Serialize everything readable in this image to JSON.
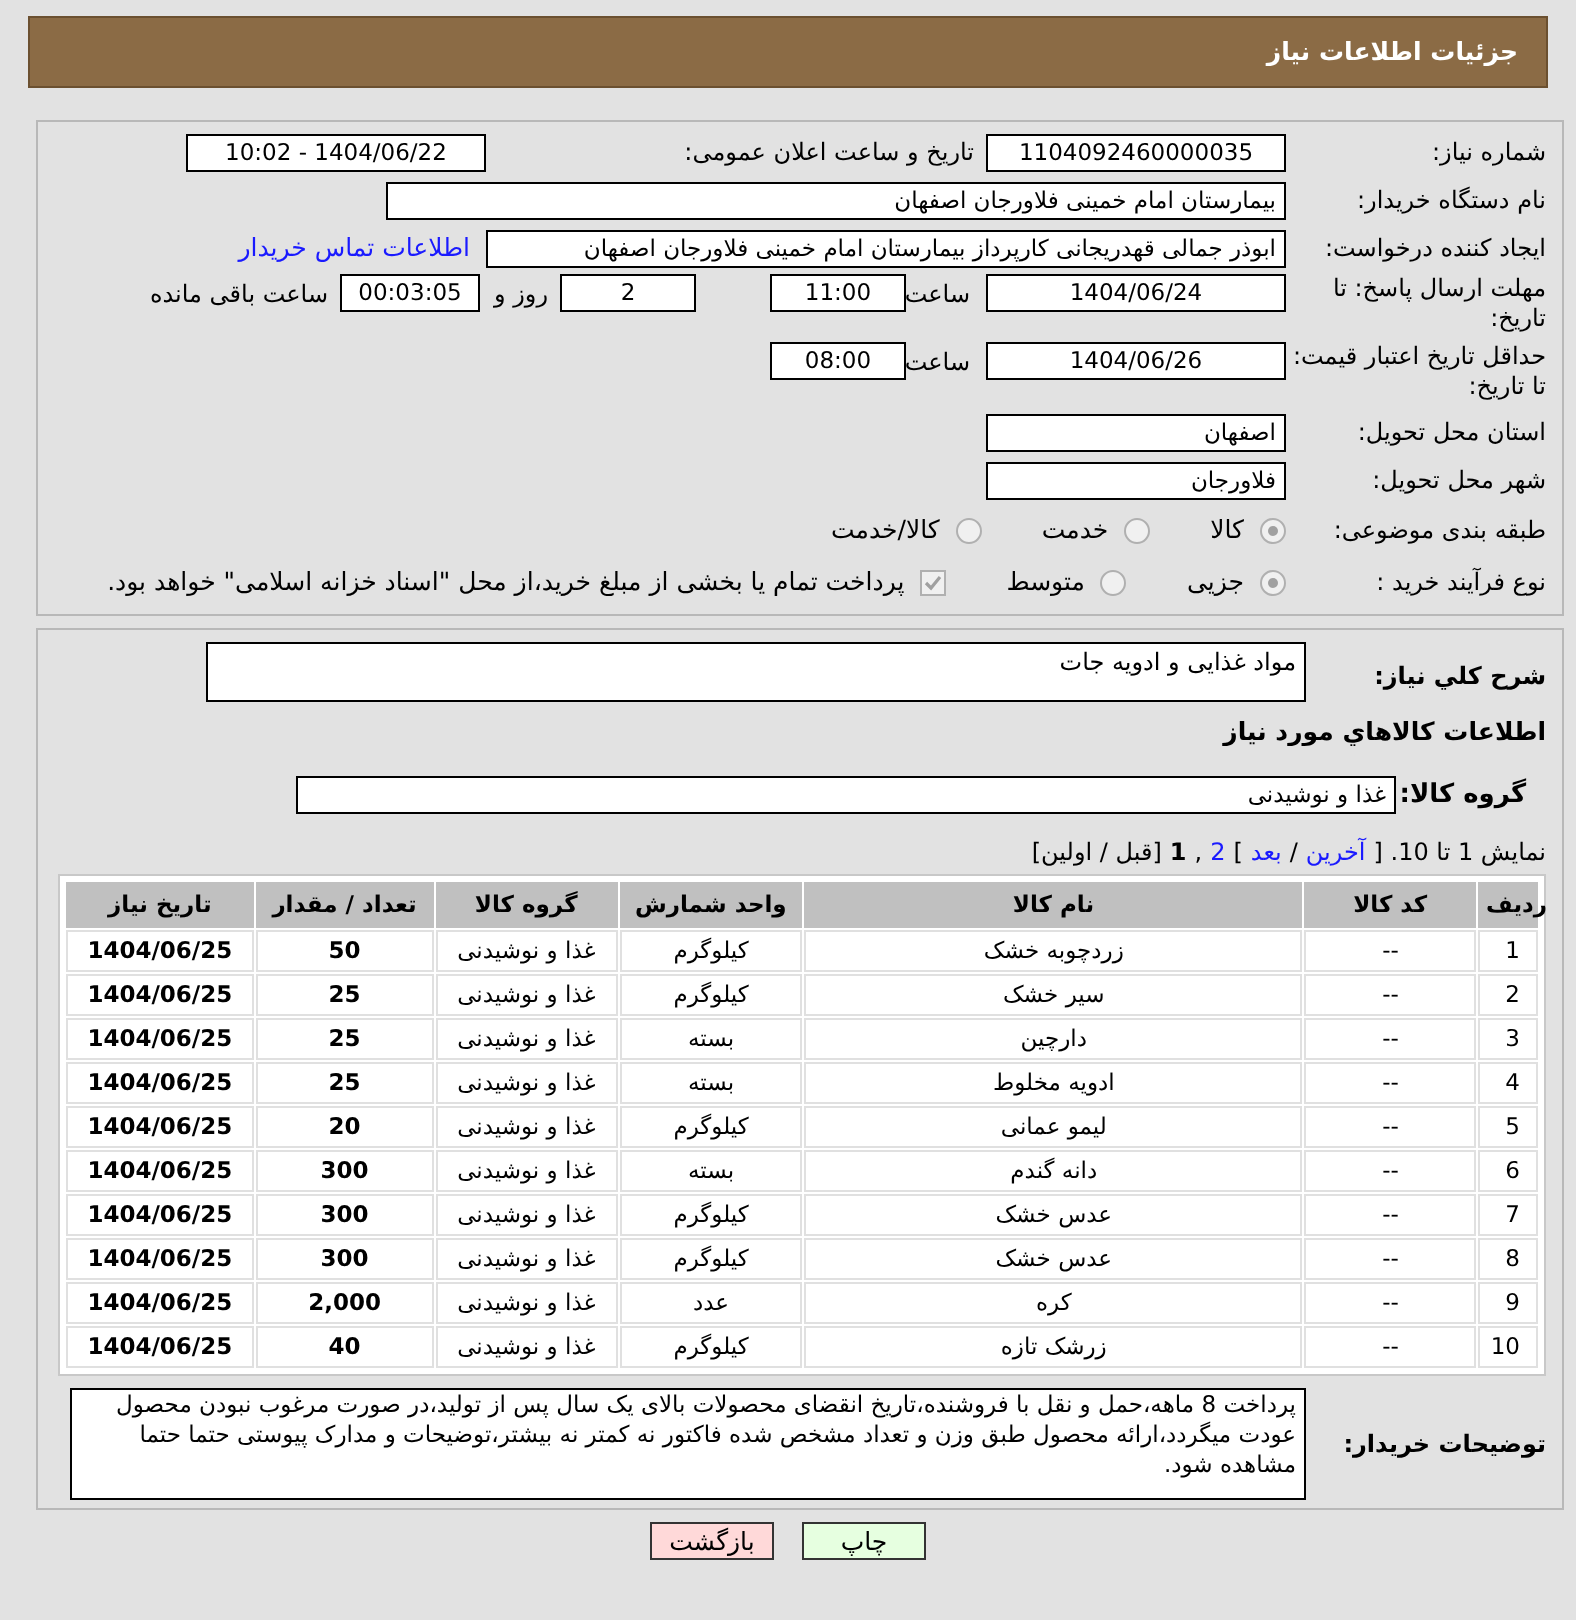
{
  "header": {
    "title": "جزئیات اطلاعات نیاز"
  },
  "need_number": {
    "label": "شماره نیاز:",
    "value": "1104092460000035"
  },
  "announce": {
    "label": "تاریخ و ساعت اعلان عمومی:",
    "value": "1404/06/22 - 10:02"
  },
  "buyer_org": {
    "label": "نام دستگاه خریدار:",
    "value": "بیمارستان امام خمینی فلاورجان اصفهان"
  },
  "requester": {
    "label": "ایجاد کننده درخواست:",
    "value": "ابوذر جمالی قهدریجانی کارپرداز بیمارستان امام خمینی فلاورجان اصفهان",
    "link": "اطلاعات تماس خریدار"
  },
  "deadline": {
    "label": "مهلت ارسال پاسخ: تا تاریخ:",
    "date": "1404/06/24",
    "time_label": "ساعت",
    "time": "11:00",
    "days": "2",
    "days_label": "روز و",
    "remaining": "00:03:05",
    "remaining_label": "ساعت باقی مانده"
  },
  "validity": {
    "label": "حداقل تاریخ اعتبار قیمت: تا تاریخ:",
    "date": "1404/06/26",
    "time_label": "ساعت",
    "time": "08:00"
  },
  "province": {
    "label": "استان محل تحویل:",
    "value": "اصفهان"
  },
  "city": {
    "label": "شهر محل تحویل:",
    "value": "فلاورجان"
  },
  "category": {
    "label": "طبقه بندی موضوعی:",
    "options": [
      {
        "label": "کالا",
        "selected": true
      },
      {
        "label": "خدمت",
        "selected": false
      },
      {
        "label": "کالا/خدمت",
        "selected": false
      }
    ]
  },
  "purchase_type": {
    "label": "نوع فرآیند خرید :",
    "options": [
      {
        "label": "جزیی",
        "selected": true
      },
      {
        "label": "متوسط",
        "selected": false
      }
    ],
    "payment_note": {
      "label": "پرداخت تمام یا بخشی از مبلغ خرید،از محل \"اسناد خزانه اسلامی\" خواهد بود.",
      "checked": true
    }
  },
  "description": {
    "label": "شرح کلي نياز:",
    "value": "مواد غذایی و ادویه جات"
  },
  "goods_title": "اطلاعات کالاهاي مورد نياز",
  "goods_group": {
    "label": "گروه کالا:",
    "value": "غذا و نوشیدنی"
  },
  "pagination": [
    {
      "kind": "text",
      "text": "نمایش 1 تا 10. ["
    },
    {
      "kind": "link",
      "text": "آخرین"
    },
    {
      "kind": "text",
      "text": "/"
    },
    {
      "kind": "link",
      "text": "بعد"
    },
    {
      "kind": "text",
      "text": "]"
    },
    {
      "kind": "link",
      "text": "2"
    },
    {
      "kind": "text",
      "text": ","
    },
    {
      "kind": "bold",
      "text": "1"
    },
    {
      "kind": "text",
      "text": "[قبل / اولین]"
    }
  ],
  "table": {
    "columns": [
      "ردیف",
      "کد کالا",
      "نام کالا",
      "واحد شمارش",
      "گروه کالا",
      "تعداد / مقدار",
      "تاریخ نیاز"
    ],
    "rows": [
      [
        "1",
        "--",
        "زردچوبه خشک",
        "کیلوگرم",
        "غذا و نوشیدنی",
        "50",
        "1404/06/25"
      ],
      [
        "2",
        "--",
        "سیر خشک",
        "کیلوگرم",
        "غذا و نوشیدنی",
        "25",
        "1404/06/25"
      ],
      [
        "3",
        "--",
        "دارچین",
        "بسته",
        "غذا و نوشیدنی",
        "25",
        "1404/06/25"
      ],
      [
        "4",
        "--",
        "ادویه مخلوط",
        "بسته",
        "غذا و نوشیدنی",
        "25",
        "1404/06/25"
      ],
      [
        "5",
        "--",
        "لیمو عمانی",
        "کیلوگرم",
        "غذا و نوشیدنی",
        "20",
        "1404/06/25"
      ],
      [
        "6",
        "--",
        "دانه گندم",
        "بسته",
        "غذا و نوشیدنی",
        "300",
        "1404/06/25"
      ],
      [
        "7",
        "--",
        "عدس خشک",
        "کیلوگرم",
        "غذا و نوشیدنی",
        "300",
        "1404/06/25"
      ],
      [
        "8",
        "--",
        "عدس خشک",
        "کیلوگرم",
        "غذا و نوشیدنی",
        "300",
        "1404/06/25"
      ],
      [
        "9",
        "--",
        "کره",
        "عدد",
        "غذا و نوشیدنی",
        "2,000",
        "1404/06/25"
      ],
      [
        "10",
        "--",
        "زرشک تازه",
        "کیلوگرم",
        "غذا و نوشیدنی",
        "40",
        "1404/06/25"
      ]
    ]
  },
  "buyer_notes": {
    "label": "توضیحات خریدار:",
    "value": "پرداخت 8 ماهه،حمل و نقل با فروشنده،تاریخ انقضای محصولات بالای یک سال پس از تولید،در صورت مرغوب نبودن محصول عودت میگردد،ارائه محصول طبق وزن و تعداد مشخص شده فاکتور نه کمتر نه بیشتر،توضیحات و مدارک پیوستی حتما حتما مشاهده شود."
  },
  "buttons": [
    {
      "kind": "print",
      "label": "چاپ"
    },
    {
      "kind": "back",
      "label": "بازگشت"
    }
  ]
}
